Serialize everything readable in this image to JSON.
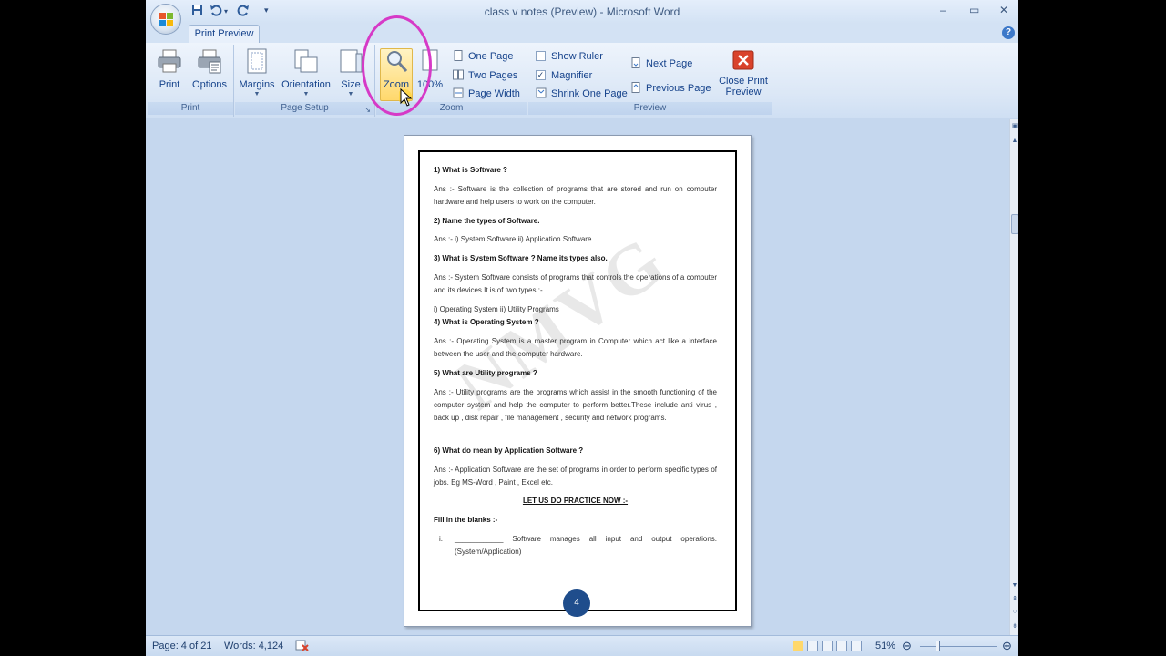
{
  "window": {
    "title": "class v notes (Preview) - Microsoft Word",
    "minimize": "–",
    "restore": "▭",
    "close": "✕"
  },
  "qat": {
    "save_icon": "save-icon",
    "undo_icon": "undo-icon",
    "redo_icon": "redo-icon",
    "customize": "▾"
  },
  "tabs": {
    "active": "Print Preview",
    "help": "?"
  },
  "ribbon": {
    "print_group": {
      "label": "Print",
      "print": "Print",
      "options": "Options"
    },
    "page_setup_group": {
      "label": "Page Setup",
      "margins": "Margins",
      "orientation": "Orientation",
      "size": "Size"
    },
    "zoom_group": {
      "label": "Zoom",
      "zoom": "Zoom",
      "hundred": "100%",
      "one_page": "One Page",
      "two_pages": "Two Pages",
      "page_width": "Page Width"
    },
    "preview_group": {
      "label": "Preview",
      "show_ruler": "Show Ruler",
      "show_ruler_checked": false,
      "magnifier": "Magnifier",
      "magnifier_checked": true,
      "shrink_one_page": "Shrink One Page",
      "next_page": "Next Page",
      "previous_page": "Previous Page",
      "close_print_preview_1": "Close Print",
      "close_print_preview_2": "Preview"
    }
  },
  "document": {
    "watermark": "NMVG",
    "page_number": "4",
    "lines": [
      "1) What is Software ?",
      "Ans :- Software is the collection of programs that are stored and run on computer hardware and help users to work on the computer.",
      "2) Name the types of Software.",
      "Ans :- i) System Software    ii) Application Software",
      "3) What is System Software ? Name its types also.",
      "Ans :- System Software consists of programs that controls the operations of a computer and its devices.It is of two types :-",
      "i)      Operating System      ii) Utility Programs",
      "4) What is Operating System  ?",
      "Ans :- Operating System is a master program in Computer which act like a interface between the user and the computer hardware.",
      "5) What  are Utility programs  ?",
      "Ans :- Utility programs are the programs which assist in the smooth functioning of the computer system  and help the computer to perform better.These include anti virus , back up , disk repair , file management , security and network programs.",
      "6) What do mean by Application Software ?",
      "Ans :- Application Software are the set of programs in order to perform specific types of jobs. Eg MS-Word , Paint , Excel etc.",
      "LET US DO PRACTICE NOW :-",
      "Fill in the blanks :-",
      "i.",
      "____________      Software manages all input and output operations.(System/Application)"
    ]
  },
  "statusbar": {
    "page": "Page: 4 of 21",
    "words": "Words: 4,124",
    "zoom": "51%",
    "zoom_out": "⊖",
    "zoom_in": "⊕"
  },
  "colors": {
    "ribbon_text": "#15428b",
    "highlight_ring": "#d63ac7",
    "zoom_active": "#ffd86c"
  }
}
